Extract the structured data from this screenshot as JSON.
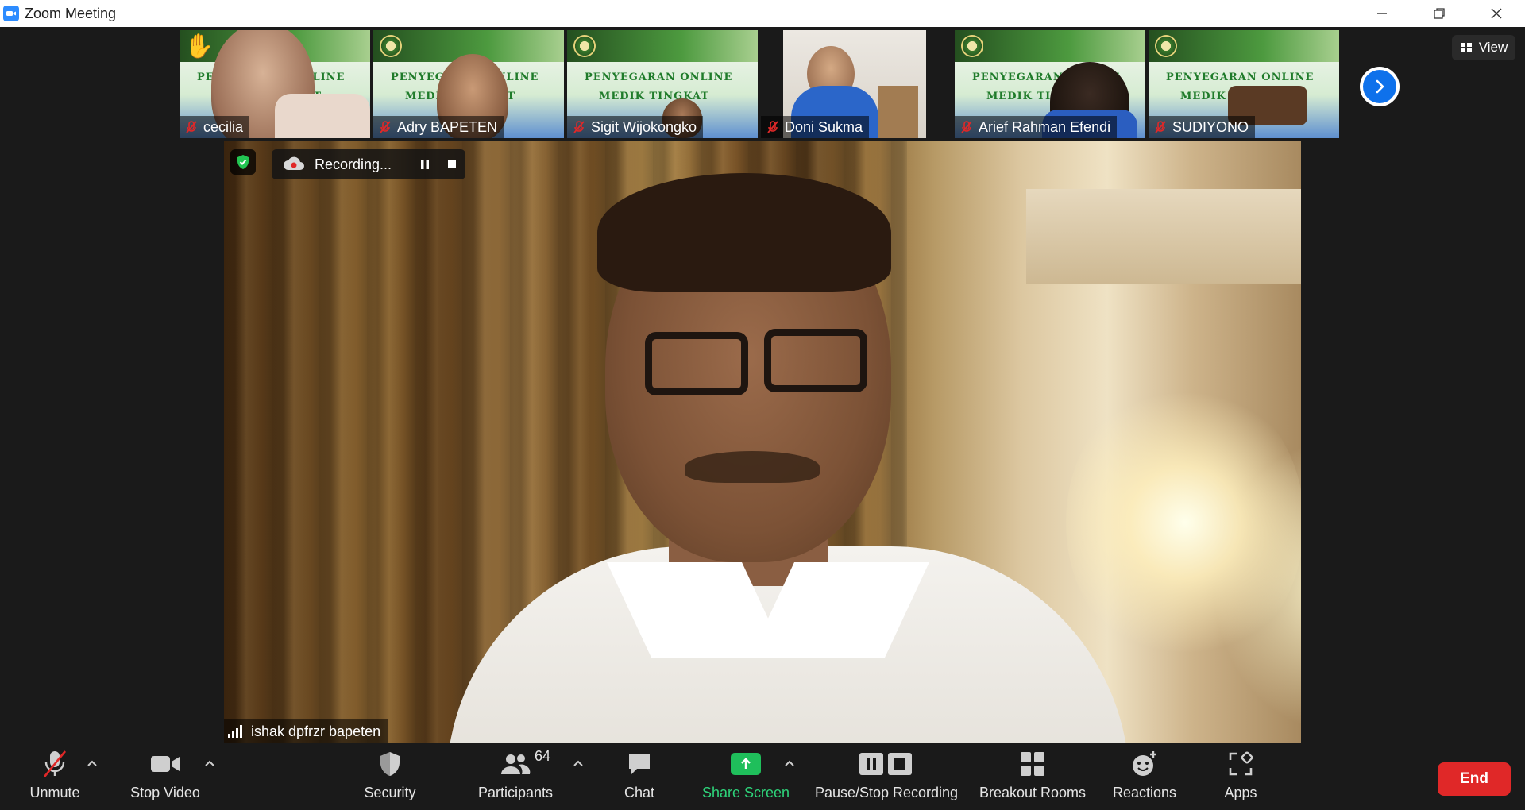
{
  "window": {
    "title": "Zoom Meeting",
    "controls": [
      "minimize",
      "restore",
      "close"
    ]
  },
  "thumbnails": [
    {
      "name": "cecilia",
      "muted": true,
      "hand_raised": true
    },
    {
      "name": "Adry BAPETEN",
      "muted": true
    },
    {
      "name": "Sigit Wijokongko",
      "muted": true
    },
    {
      "name": "Doni Sukma",
      "muted": true
    },
    {
      "name": "Arief Rahman Efendi",
      "muted": true
    },
    {
      "name": "SUDIYONO",
      "muted": true
    }
  ],
  "slide": {
    "line1": "PENYEGARAN ONLINE",
    "line2": "MEDIK TINGKAT"
  },
  "view_button": {
    "label": "View"
  },
  "main_video": {
    "speaker_name": "ishak dpfrzr bapeten",
    "recording_label": "Recording..."
  },
  "toolbar": {
    "unmute": "Unmute",
    "stop_video": "Stop Video",
    "security": "Security",
    "participants": "Participants",
    "participants_count": "64",
    "chat": "Chat",
    "share_screen": "Share Screen",
    "pause_stop_recording": "Pause/Stop Recording",
    "breakout_rooms": "Breakout Rooms",
    "reactions": "Reactions",
    "apps": "Apps",
    "end": "End"
  },
  "colors": {
    "accent_blue": "#0e71eb",
    "share_green": "#1fbf5b",
    "end_red": "#e02828",
    "muted_red": "#e02828"
  }
}
